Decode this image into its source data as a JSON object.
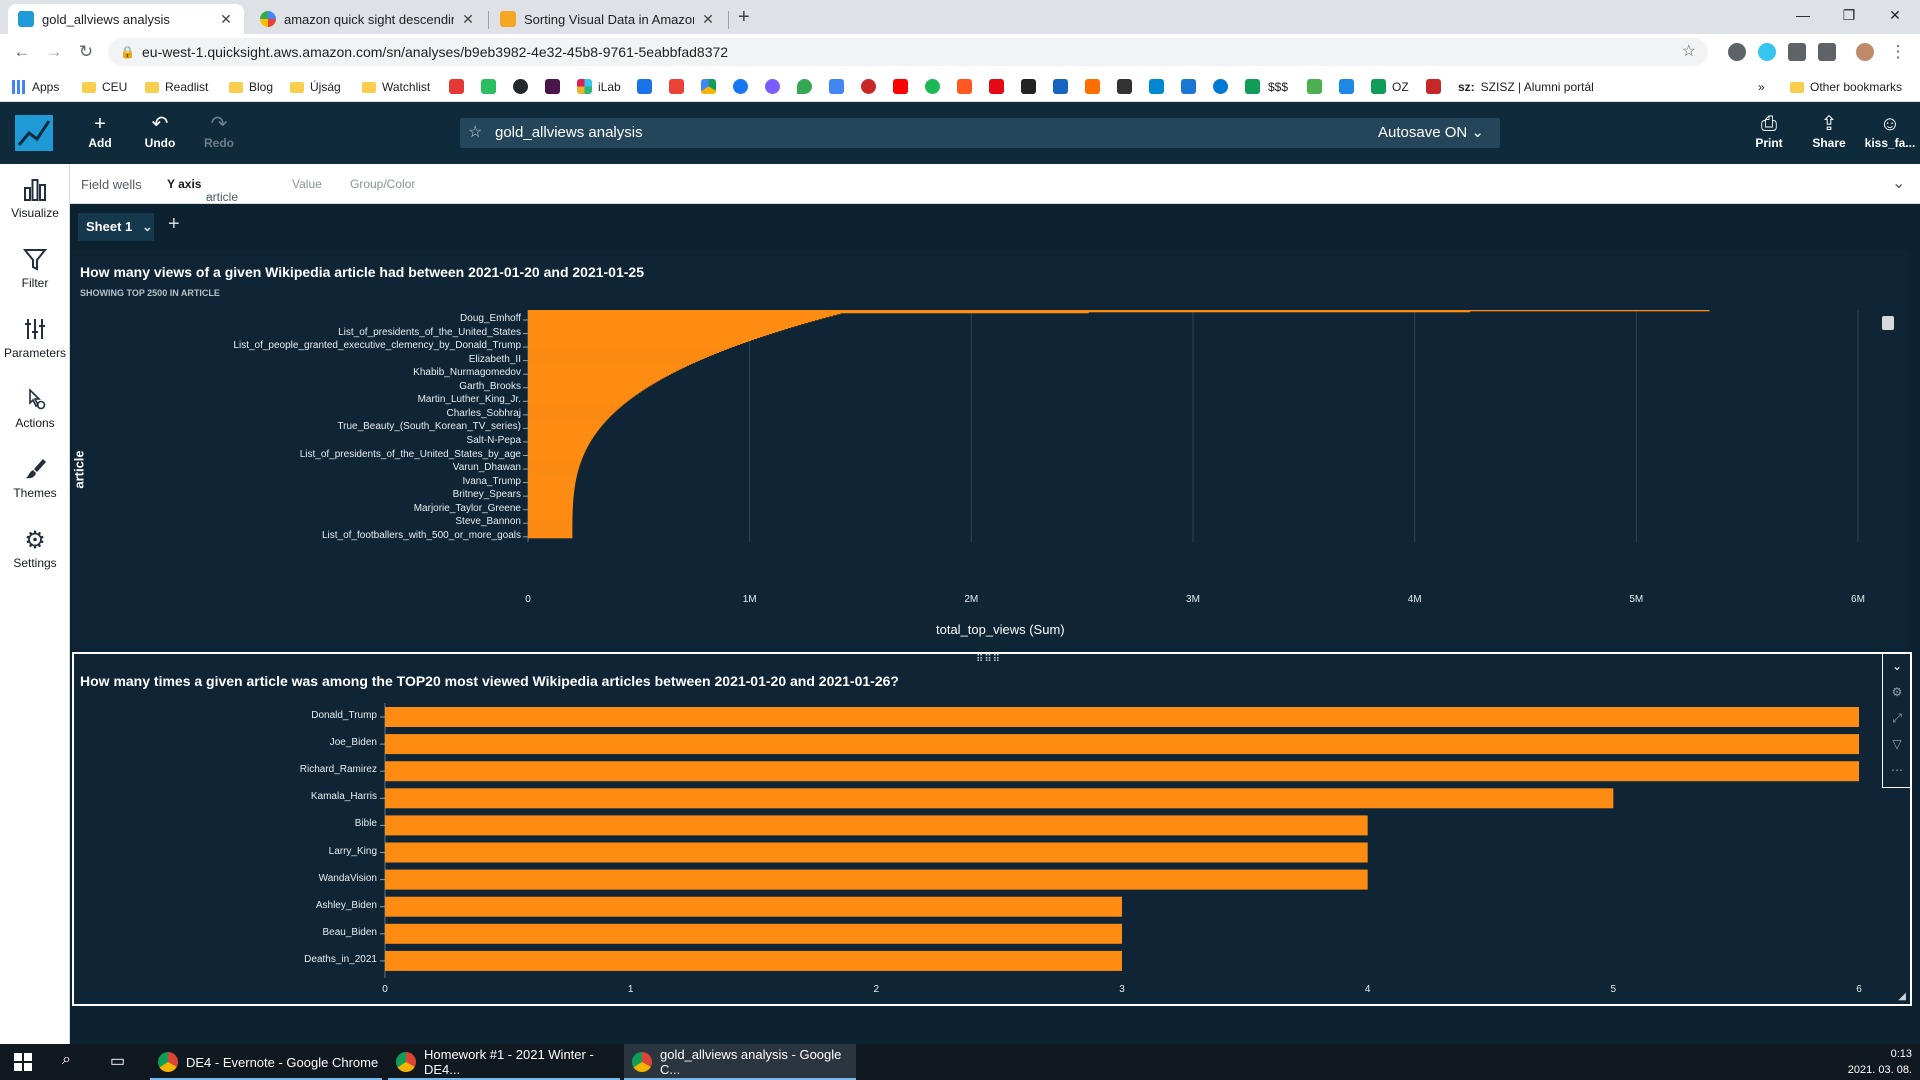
{
  "browser": {
    "tabs": [
      {
        "title": "gold_allviews analysis",
        "active": true,
        "favicon": "quicksight-icon"
      },
      {
        "title": "amazon quick sight descending o",
        "active": false,
        "favicon": "google-icon"
      },
      {
        "title": "Sorting Visual Data in Amazon Q",
        "active": false,
        "favicon": "aws-docs-icon"
      }
    ],
    "new_tab": "+",
    "url": "eu-west-1.quicksight.aws.amazon.com/sn/analyses/b9eb3982-4e32-45b8-9761-5eabbfad8372",
    "bookmarks": [
      "Apps",
      "CEU",
      "Readlist",
      "Blog",
      "Újság",
      "Watchlist",
      "iLab",
      "$$$",
      "OZ",
      "SZISZ | Alumni portál"
    ],
    "bookmark_prefix": "sz:",
    "overflow": "»",
    "other_bookmarks": "Other bookmarks"
  },
  "qs_header": {
    "add": "Add",
    "undo": "Undo",
    "redo": "Redo",
    "analysis_name": "gold_allviews analysis",
    "autosave": "Autosave ON",
    "print": "Print",
    "share": "Share",
    "user": "kiss_fa..."
  },
  "rail": [
    "Visualize",
    "Filter",
    "Parameters",
    "Actions",
    "Themes",
    "Settings"
  ],
  "field_wells": {
    "label": "Field wells",
    "y_axis_label": "Y axis",
    "y_axis_field": "article",
    "value": "Value",
    "group_color": "Group/Color"
  },
  "sheet": {
    "name": "Sheet 1",
    "add": "+"
  },
  "visual1": {
    "title": "How many views of a given Wikipedia article had between 2021-01-20 and 2021-01-25",
    "subtitle": "SHOWING TOP 2500 IN ARTICLE",
    "y_title": "article",
    "x_title": "total_top_views (Sum)",
    "x_ticks": [
      "0",
      "1M",
      "2M",
      "3M",
      "4M",
      "5M",
      "6M"
    ],
    "categories": [
      "Doug_Emhoff",
      "List_of_presidents_of_the_United_States",
      "List_of_people_granted_executive_clemency_by_Donald_Trump",
      "Elizabeth_II",
      "Khabib_Nurmagomedov",
      "Garth_Brooks",
      "Martin_Luther_King_Jr.",
      "Charles_Sobhraj",
      "True_Beauty_(South_Korean_TV_series)",
      "Salt-N-Pepa",
      "List_of_presidents_of_the_United_States_by_age",
      "Varun_Dhawan",
      "Ivana_Trump",
      "Britney_Spears",
      "Marjorie_Taylor_Greene",
      "Steve_Bannon",
      "List_of_footballers_with_500_or_more_goals"
    ]
  },
  "visual2": {
    "title": "How many times a given article was among the TOP20 most viewed Wikipedia articles between 2021-01-20 and 2021-01-26?",
    "x_ticks": [
      "0",
      "1",
      "2",
      "3",
      "4",
      "5",
      "6"
    ]
  },
  "chart_data": [
    {
      "type": "bar",
      "orientation": "horizontal",
      "title": "How many views of a given Wikipedia article had between 2021-01-20 and 2021-01-25",
      "subtitle": "SHOWING TOP 2500 IN ARTICLE",
      "xlabel": "total_top_views (Sum)",
      "ylabel": "article",
      "xlim": [
        0,
        6000000
      ],
      "grid": true,
      "categories": [
        "Doug_Emhoff",
        "List_of_presidents_of_the_United_States",
        "List_of_people_granted_executive_clemency_by_Donald_Trump",
        "Elizabeth_II",
        "Khabib_Nurmagomedov",
        "Garth_Brooks",
        "Martin_Luther_King_Jr.",
        "Charles_Sobhraj",
        "True_Beauty_(South_Korean_TV_series)",
        "Salt-N-Pepa",
        "List_of_presidents_of_the_United_States_by_age",
        "Varun_Dhawan",
        "Ivana_Trump",
        "Britney_Spears",
        "Marjorie_Taylor_Greene",
        "Steve_Bannon",
        "List_of_footballers_with_500_or_more_goals"
      ],
      "values": [
        1410000,
        1000000,
        620000,
        500000,
        420000,
        370000,
        330000,
        300000,
        290000,
        260000,
        250000,
        240000,
        230000,
        225000,
        220000,
        210000,
        200000
      ],
      "top_values": [
        5330000,
        4250000,
        2530000
      ]
    },
    {
      "type": "bar",
      "orientation": "horizontal",
      "title": "How many times a given article was among the TOP20 most viewed Wikipedia articles between 2021-01-20 and 2021-01-26?",
      "xlim": [
        0,
        6
      ],
      "grid": false,
      "categories": [
        "Donald_Trump",
        "Joe_Biden",
        "Richard_Ramirez",
        "Kamala_Harris",
        "Bible",
        "Larry_King",
        "WandaVision",
        "Ashley_Biden",
        "Beau_Biden",
        "Deaths_in_2021"
      ],
      "values": [
        6,
        6,
        6,
        5,
        4,
        4,
        4,
        3,
        3,
        3
      ]
    }
  ],
  "colors": {
    "bar": "#ff8c12",
    "background": "#0d2231",
    "header": "#0e2a3b",
    "accent": "#1e9ad6"
  },
  "taskbar": {
    "apps": [
      "DE4 - Evernote - Google Chrome",
      "Homework #1 - 2021 Winter - DE4...",
      "gold_allviews analysis - Google C..."
    ],
    "time": "0:13",
    "date": "2021. 03. 08."
  }
}
